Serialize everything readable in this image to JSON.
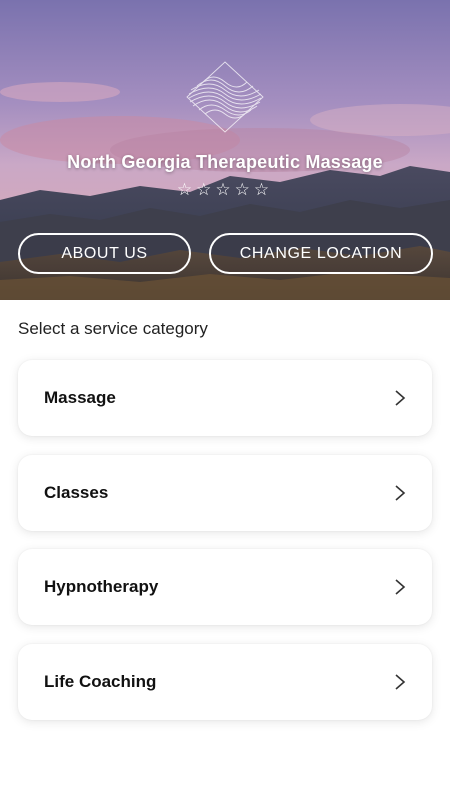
{
  "header": {
    "business_name": "North Georgia Therapeutic Massage",
    "rating": {
      "stars": 0,
      "max": 5,
      "glyph": "☆"
    },
    "logo_icon": "wave-globe-logo-icon"
  },
  "actions": {
    "about_label": "ABOUT US",
    "location_label": "CHANGE LOCATION"
  },
  "services": {
    "heading": "Select a service category",
    "items": [
      {
        "label": "Massage"
      },
      {
        "label": "Classes"
      },
      {
        "label": "Hypnotherapy"
      },
      {
        "label": "Life Coaching"
      }
    ],
    "chevron_icon": "chevron-right-icon"
  },
  "colors": {
    "accent_text": "#111111",
    "hero_text": "#ffffff",
    "card_bg": "#ffffff"
  }
}
